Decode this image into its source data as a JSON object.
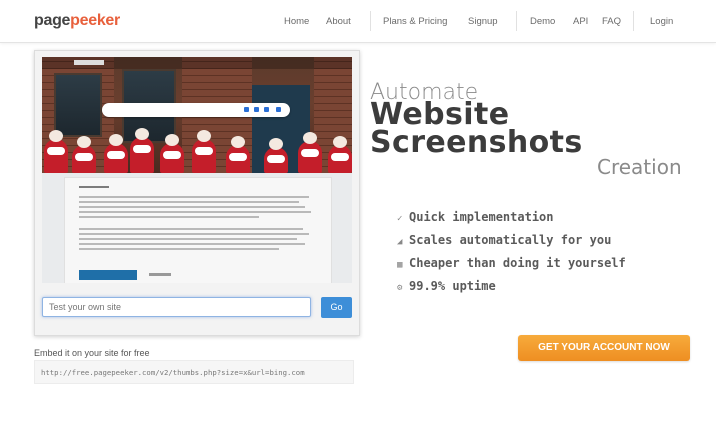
{
  "logo": {
    "part1": "page",
    "part2": "peeker"
  },
  "nav": {
    "home": "Home",
    "about": "About",
    "plans": "Plans & Pricing",
    "signup": "Signup",
    "demo": "Demo",
    "api": "API",
    "faq": "FAQ",
    "login": "Login"
  },
  "hero": {
    "line1": "Automate",
    "line2": "Website",
    "line3": "Screenshots",
    "line4": "Creation"
  },
  "features": [
    {
      "icon": "pencil-icon",
      "glyph": "✓",
      "text": "Quick implementation"
    },
    {
      "icon": "chart-icon",
      "glyph": "◢",
      "text": "Scales automatically for you"
    },
    {
      "icon": "grid-icon",
      "glyph": "▦",
      "text": "Cheaper than doing it yourself"
    },
    {
      "icon": "circle-icon",
      "glyph": "⚙",
      "text": "99.9% uptime"
    }
  ],
  "test": {
    "placeholder": "Test your own site",
    "go_label": "Go"
  },
  "embed": {
    "label": "Embed it on your site for free",
    "code": "http://free.pagepeeker.com/v2/thumbs.php?size=x&url=bing.com"
  },
  "cta": {
    "label": "GET YOUR ACCOUNT NOW"
  },
  "colors": {
    "brand": "#e8603c",
    "cta": "#f39c2c",
    "go": "#3d8ed8"
  }
}
